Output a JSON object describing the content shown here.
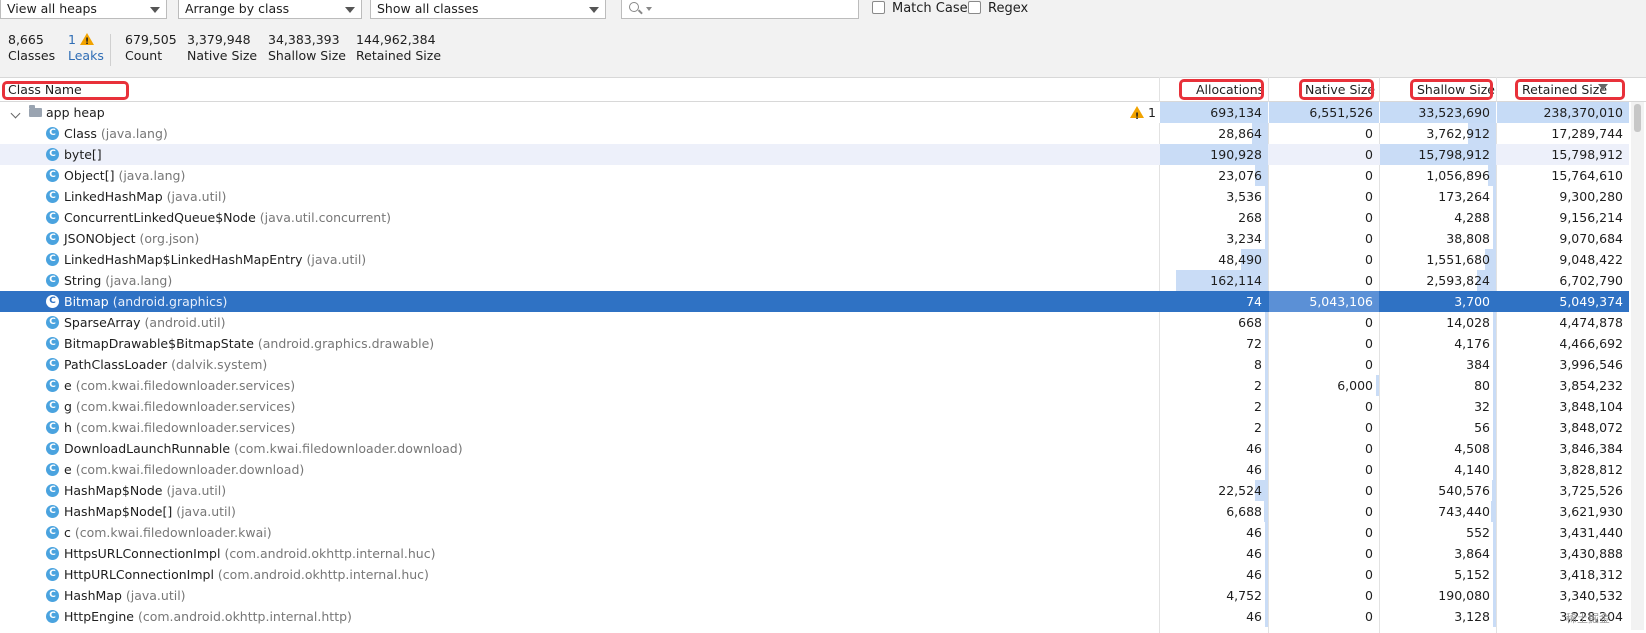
{
  "toolbar": {
    "heap_select": "View all heaps",
    "arrange_select": "Arrange by class",
    "classes_select": "Show all classes",
    "search_placeholder": "",
    "match_case_label": "Match Case",
    "regex_label": "Regex"
  },
  "stats": {
    "classes_value": "8,665",
    "classes_label": "Classes",
    "leaks_value": "1",
    "leaks_label": "Leaks",
    "count_value": "679,505",
    "count_label": "Count",
    "native_value": "3,379,948",
    "native_label": "Native Size",
    "shallow_value": "34,383,393",
    "shallow_label": "Shallow Size",
    "retained_value": "144,962,384",
    "retained_label": "Retained Size"
  },
  "columns": {
    "class_name": "Class Name",
    "allocations": "Allocations",
    "native_size": "Native Size",
    "shallow_size": "Shallow Size",
    "retained_size": "Retained Size"
  },
  "heap_row": {
    "name": "app heap",
    "leak_count": "1",
    "allocations": "693,134",
    "native_size": "6,551,526",
    "shallow_size": "33,523,690",
    "retained_size": "238,370,010"
  },
  "rows": [
    {
      "name": "Class",
      "pkg": "(java.lang)",
      "alloc": "28,864",
      "native": "0",
      "shallow": "3,762,912",
      "retained": "17,289,744"
    },
    {
      "name": "byte[]",
      "pkg": "",
      "alloc": "190,928",
      "native": "0",
      "shallow": "15,798,912",
      "retained": "15,798,912"
    },
    {
      "name": "Object[]",
      "pkg": "(java.lang)",
      "alloc": "23,076",
      "native": "0",
      "shallow": "1,056,896",
      "retained": "15,764,610"
    },
    {
      "name": "LinkedHashMap",
      "pkg": "(java.util)",
      "alloc": "3,536",
      "native": "0",
      "shallow": "173,264",
      "retained": "9,300,280"
    },
    {
      "name": "ConcurrentLinkedQueue$Node",
      "pkg": "(java.util.concurrent)",
      "alloc": "268",
      "native": "0",
      "shallow": "4,288",
      "retained": "9,156,214"
    },
    {
      "name": "JSONObject",
      "pkg": "(org.json)",
      "alloc": "3,234",
      "native": "0",
      "shallow": "38,808",
      "retained": "9,070,684"
    },
    {
      "name": "LinkedHashMap$LinkedHashMapEntry",
      "pkg": "(java.util)",
      "alloc": "48,490",
      "native": "0",
      "shallow": "1,551,680",
      "retained": "9,048,422"
    },
    {
      "name": "String",
      "pkg": "(java.lang)",
      "alloc": "162,114",
      "native": "0",
      "shallow": "2,593,824",
      "retained": "6,702,790"
    },
    {
      "name": "Bitmap",
      "pkg": "(android.graphics)",
      "alloc": "74",
      "native": "5,043,106",
      "shallow": "3,700",
      "retained": "5,049,374"
    },
    {
      "name": "SparseArray",
      "pkg": "(android.util)",
      "alloc": "668",
      "native": "0",
      "shallow": "14,028",
      "retained": "4,474,878"
    },
    {
      "name": "BitmapDrawable$BitmapState",
      "pkg": "(android.graphics.drawable)",
      "alloc": "72",
      "native": "0",
      "shallow": "4,176",
      "retained": "4,466,692"
    },
    {
      "name": "PathClassLoader",
      "pkg": "(dalvik.system)",
      "alloc": "8",
      "native": "0",
      "shallow": "384",
      "retained": "3,996,546"
    },
    {
      "name": "e",
      "pkg": "(com.kwai.filedownloader.services)",
      "alloc": "2",
      "native": "6,000",
      "shallow": "80",
      "retained": "3,854,232"
    },
    {
      "name": "g",
      "pkg": "(com.kwai.filedownloader.services)",
      "alloc": "2",
      "native": "0",
      "shallow": "32",
      "retained": "3,848,104"
    },
    {
      "name": "h",
      "pkg": "(com.kwai.filedownloader.services)",
      "alloc": "2",
      "native": "0",
      "shallow": "56",
      "retained": "3,848,072"
    },
    {
      "name": "DownloadLaunchRunnable",
      "pkg": "(com.kwai.filedownloader.download)",
      "alloc": "46",
      "native": "0",
      "shallow": "4,508",
      "retained": "3,846,384"
    },
    {
      "name": "e",
      "pkg": "(com.kwai.filedownloader.download)",
      "alloc": "46",
      "native": "0",
      "shallow": "4,140",
      "retained": "3,828,812"
    },
    {
      "name": "HashMap$Node",
      "pkg": "(java.util)",
      "alloc": "22,524",
      "native": "0",
      "shallow": "540,576",
      "retained": "3,725,526"
    },
    {
      "name": "HashMap$Node[]",
      "pkg": "(java.util)",
      "alloc": "6,688",
      "native": "0",
      "shallow": "743,440",
      "retained": "3,621,930"
    },
    {
      "name": "c",
      "pkg": "(com.kwai.filedownloader.kwai)",
      "alloc": "46",
      "native": "0",
      "shallow": "552",
      "retained": "3,431,440"
    },
    {
      "name": "HttpsURLConnectionImpl",
      "pkg": "(com.android.okhttp.internal.huc)",
      "alloc": "46",
      "native": "0",
      "shallow": "3,864",
      "retained": "3,430,888"
    },
    {
      "name": "HttpURLConnectionImpl",
      "pkg": "(com.android.okhttp.internal.huc)",
      "alloc": "46",
      "native": "0",
      "shallow": "5,152",
      "retained": "3,418,312"
    },
    {
      "name": "HashMap",
      "pkg": "(java.util)",
      "alloc": "4,752",
      "native": "0",
      "shallow": "190,080",
      "retained": "3,340,532"
    },
    {
      "name": "HttpEngine",
      "pkg": "(com.android.okhttp.internal.http)",
      "alloc": "46",
      "native": "0",
      "shallow": "3,128",
      "retained": "3,228,204"
    }
  ],
  "selected_row": 8,
  "alt_row": 1,
  "colors": {
    "selection": "#2f72c4",
    "bar": "#c9dcf6",
    "highlight_box": "#e8313a",
    "warning": "#f1a300"
  },
  "watermark": "稀土掘金"
}
